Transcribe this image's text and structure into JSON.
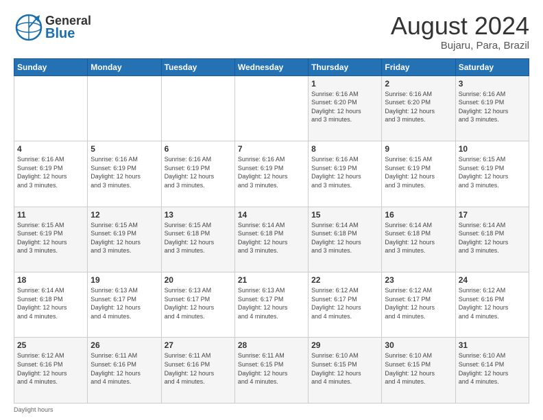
{
  "header": {
    "logo_general": "General",
    "logo_blue": "Blue",
    "month_year": "August 2024",
    "location": "Bujaru, Para, Brazil"
  },
  "calendar": {
    "days_of_week": [
      "Sunday",
      "Monday",
      "Tuesday",
      "Wednesday",
      "Thursday",
      "Friday",
      "Saturday"
    ],
    "weeks": [
      [
        {
          "day": "",
          "info": ""
        },
        {
          "day": "",
          "info": ""
        },
        {
          "day": "",
          "info": ""
        },
        {
          "day": "",
          "info": ""
        },
        {
          "day": "1",
          "info": "Sunrise: 6:16 AM\nSunset: 6:20 PM\nDaylight: 12 hours\nand 3 minutes."
        },
        {
          "day": "2",
          "info": "Sunrise: 6:16 AM\nSunset: 6:20 PM\nDaylight: 12 hours\nand 3 minutes."
        },
        {
          "day": "3",
          "info": "Sunrise: 6:16 AM\nSunset: 6:19 PM\nDaylight: 12 hours\nand 3 minutes."
        }
      ],
      [
        {
          "day": "4",
          "info": "Sunrise: 6:16 AM\nSunset: 6:19 PM\nDaylight: 12 hours\nand 3 minutes."
        },
        {
          "day": "5",
          "info": "Sunrise: 6:16 AM\nSunset: 6:19 PM\nDaylight: 12 hours\nand 3 minutes."
        },
        {
          "day": "6",
          "info": "Sunrise: 6:16 AM\nSunset: 6:19 PM\nDaylight: 12 hours\nand 3 minutes."
        },
        {
          "day": "7",
          "info": "Sunrise: 6:16 AM\nSunset: 6:19 PM\nDaylight: 12 hours\nand 3 minutes."
        },
        {
          "day": "8",
          "info": "Sunrise: 6:16 AM\nSunset: 6:19 PM\nDaylight: 12 hours\nand 3 minutes."
        },
        {
          "day": "9",
          "info": "Sunrise: 6:15 AM\nSunset: 6:19 PM\nDaylight: 12 hours\nand 3 minutes."
        },
        {
          "day": "10",
          "info": "Sunrise: 6:15 AM\nSunset: 6:19 PM\nDaylight: 12 hours\nand 3 minutes."
        }
      ],
      [
        {
          "day": "11",
          "info": "Sunrise: 6:15 AM\nSunset: 6:19 PM\nDaylight: 12 hours\nand 3 minutes."
        },
        {
          "day": "12",
          "info": "Sunrise: 6:15 AM\nSunset: 6:19 PM\nDaylight: 12 hours\nand 3 minutes."
        },
        {
          "day": "13",
          "info": "Sunrise: 6:15 AM\nSunset: 6:18 PM\nDaylight: 12 hours\nand 3 minutes."
        },
        {
          "day": "14",
          "info": "Sunrise: 6:14 AM\nSunset: 6:18 PM\nDaylight: 12 hours\nand 3 minutes."
        },
        {
          "day": "15",
          "info": "Sunrise: 6:14 AM\nSunset: 6:18 PM\nDaylight: 12 hours\nand 3 minutes."
        },
        {
          "day": "16",
          "info": "Sunrise: 6:14 AM\nSunset: 6:18 PM\nDaylight: 12 hours\nand 3 minutes."
        },
        {
          "day": "17",
          "info": "Sunrise: 6:14 AM\nSunset: 6:18 PM\nDaylight: 12 hours\nand 3 minutes."
        }
      ],
      [
        {
          "day": "18",
          "info": "Sunrise: 6:14 AM\nSunset: 6:18 PM\nDaylight: 12 hours\nand 4 minutes."
        },
        {
          "day": "19",
          "info": "Sunrise: 6:13 AM\nSunset: 6:17 PM\nDaylight: 12 hours\nand 4 minutes."
        },
        {
          "day": "20",
          "info": "Sunrise: 6:13 AM\nSunset: 6:17 PM\nDaylight: 12 hours\nand 4 minutes."
        },
        {
          "day": "21",
          "info": "Sunrise: 6:13 AM\nSunset: 6:17 PM\nDaylight: 12 hours\nand 4 minutes."
        },
        {
          "day": "22",
          "info": "Sunrise: 6:12 AM\nSunset: 6:17 PM\nDaylight: 12 hours\nand 4 minutes."
        },
        {
          "day": "23",
          "info": "Sunrise: 6:12 AM\nSunset: 6:17 PM\nDaylight: 12 hours\nand 4 minutes."
        },
        {
          "day": "24",
          "info": "Sunrise: 6:12 AM\nSunset: 6:16 PM\nDaylight: 12 hours\nand 4 minutes."
        }
      ],
      [
        {
          "day": "25",
          "info": "Sunrise: 6:12 AM\nSunset: 6:16 PM\nDaylight: 12 hours\nand 4 minutes."
        },
        {
          "day": "26",
          "info": "Sunrise: 6:11 AM\nSunset: 6:16 PM\nDaylight: 12 hours\nand 4 minutes."
        },
        {
          "day": "27",
          "info": "Sunrise: 6:11 AM\nSunset: 6:16 PM\nDaylight: 12 hours\nand 4 minutes."
        },
        {
          "day": "28",
          "info": "Sunrise: 6:11 AM\nSunset: 6:15 PM\nDaylight: 12 hours\nand 4 minutes."
        },
        {
          "day": "29",
          "info": "Sunrise: 6:10 AM\nSunset: 6:15 PM\nDaylight: 12 hours\nand 4 minutes."
        },
        {
          "day": "30",
          "info": "Sunrise: 6:10 AM\nSunset: 6:15 PM\nDaylight: 12 hours\nand 4 minutes."
        },
        {
          "day": "31",
          "info": "Sunrise: 6:10 AM\nSunset: 6:14 PM\nDaylight: 12 hours\nand 4 minutes."
        }
      ]
    ]
  },
  "footer": {
    "daylight_label": "Daylight hours"
  }
}
